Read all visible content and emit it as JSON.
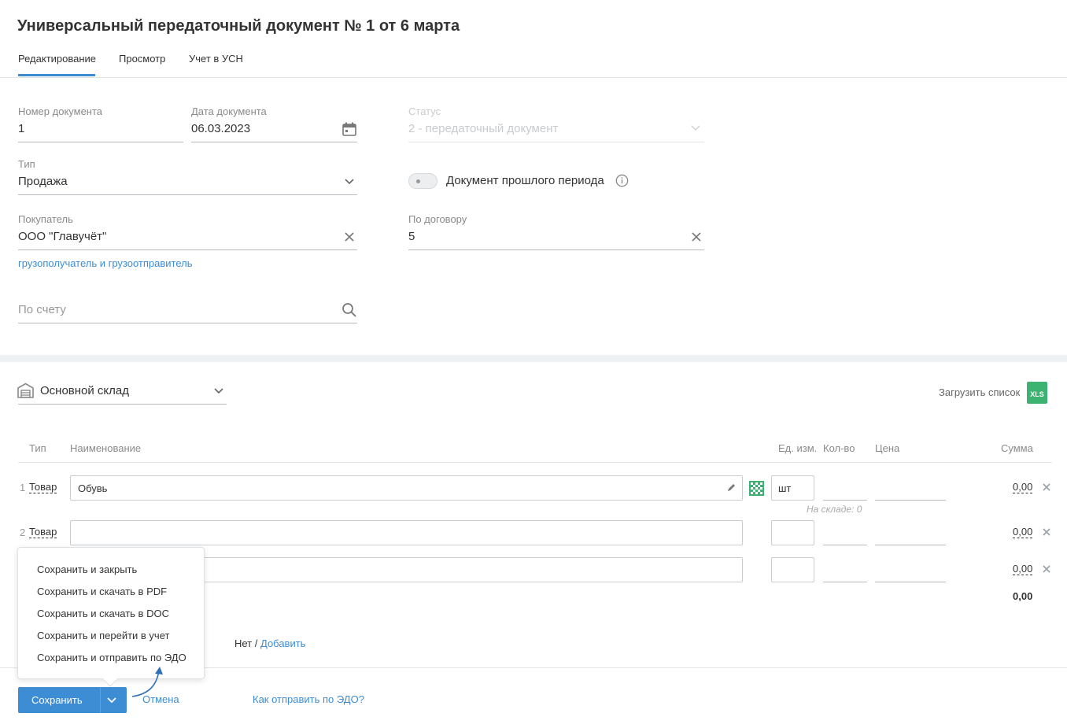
{
  "title": "Универсальный передаточный документ № 1 от 6 марта",
  "tabs": [
    {
      "label": "Редактирование",
      "active": true
    },
    {
      "label": "Просмотр",
      "active": false
    },
    {
      "label": "Учет в УСН",
      "active": false
    }
  ],
  "form": {
    "doc_number_label": "Номер документа",
    "doc_number_value": "1",
    "doc_date_label": "Дата документа",
    "doc_date_value": "06.03.2023",
    "status_label": "Статус",
    "status_value": "2 - передаточный документ",
    "type_label": "Тип",
    "type_value": "Продажа",
    "past_period_label": "Документ прошлого периода",
    "past_period_on": false,
    "buyer_label": "Покупатель",
    "buyer_value": "ООО \"Главучёт\"",
    "contract_label": "По договору",
    "contract_value": "5",
    "consignee_link": "грузополучатель и грузоотправитель",
    "invoice_placeholder": "По счету"
  },
  "warehouse": {
    "value": "Основной склад",
    "upload_label": "Загрузить список",
    "upload_icon_text": "XLS"
  },
  "table": {
    "headers": {
      "type": "Тип",
      "name": "Наименование",
      "unit": "Ед. изм.",
      "qty": "Кол-во",
      "price": "Цена",
      "sum": "Сумма"
    },
    "rows": [
      {
        "num": "1",
        "type": "Товар",
        "name": "Обувь",
        "unit": "шт",
        "sum": "0,00",
        "stock_note": "На складе: 0"
      },
      {
        "num": "2",
        "type": "Товар",
        "name": "",
        "unit": "",
        "sum": "0,00"
      },
      {
        "num": "",
        "type": "",
        "name": "",
        "unit": "",
        "sum": "0,00"
      }
    ],
    "total": "0,00"
  },
  "extra": {
    "none_label": "Нет /",
    "add_link": "Добавить"
  },
  "save_menu": {
    "items": [
      "Сохранить и закрыть",
      "Сохранить и скачать в PDF",
      "Сохранить и скачать в DOC",
      "Сохранить и перейти в учет",
      "Сохранить и отправить по ЭДО"
    ]
  },
  "footer": {
    "save_label": "Сохранить",
    "cancel_label": "Отмена",
    "edo_help_link": "Как отправить по ЭДО?"
  },
  "colors": {
    "accent": "#3d8dd5",
    "xls_green": "#3cb371"
  }
}
